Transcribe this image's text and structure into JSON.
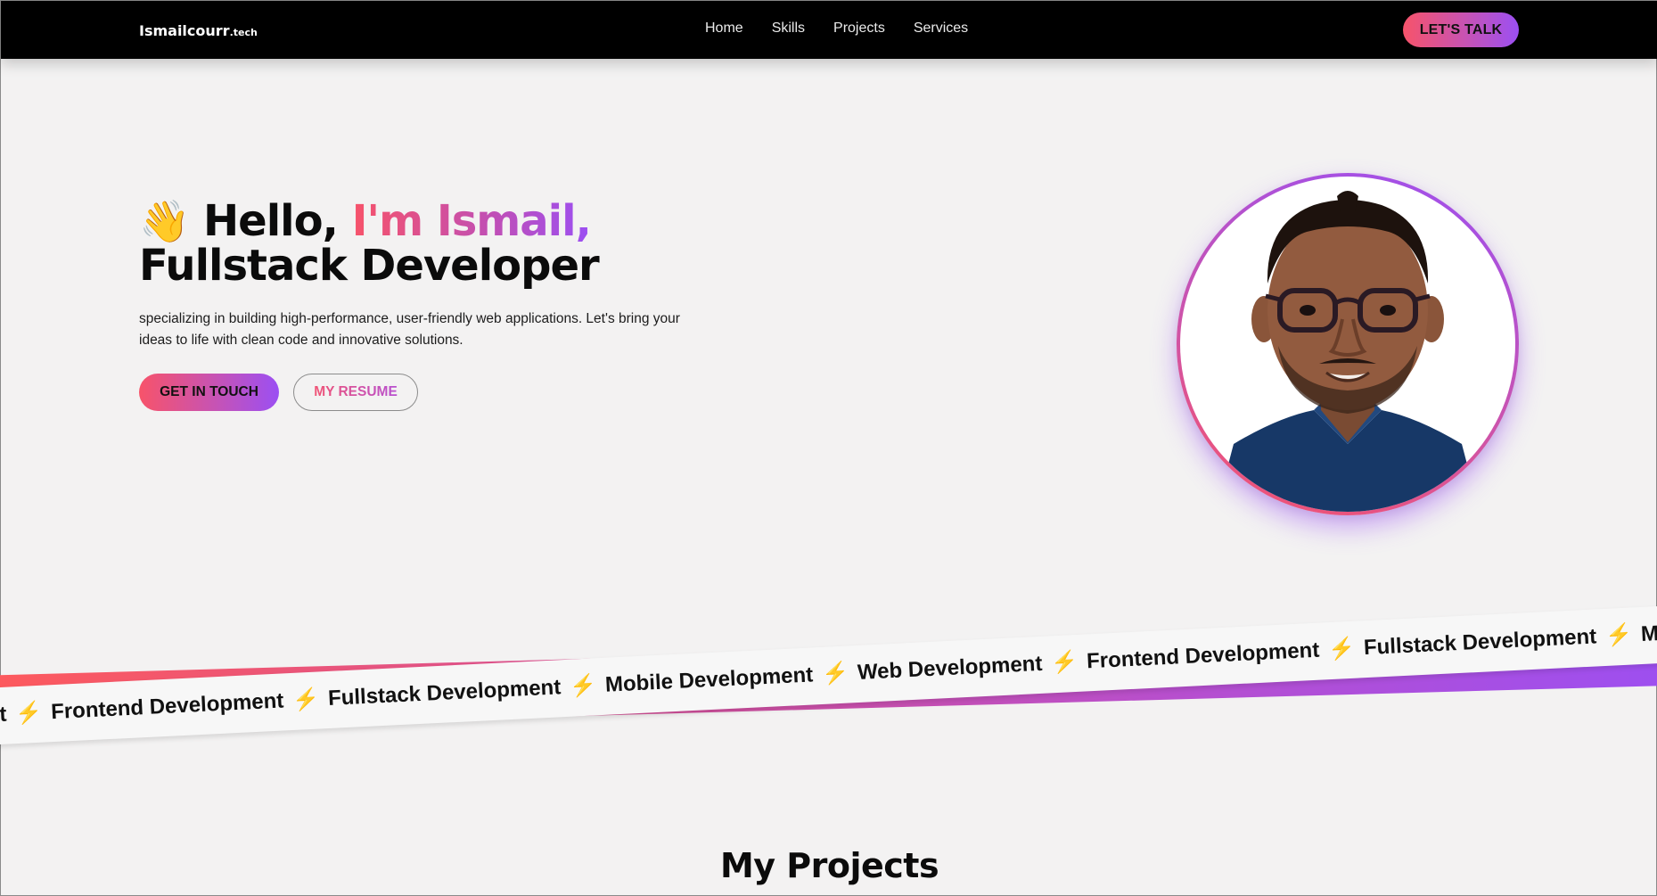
{
  "nav": {
    "logo_main": "Ismailcourr",
    "logo_tld": ".tech",
    "links": [
      "Home",
      "Skills",
      "Projects",
      "Services"
    ],
    "cta": "LET'S TALK"
  },
  "hero": {
    "wave": "👋",
    "hello": "Hello,",
    "name": "I'm Ismail,",
    "role": "Fullstack Developer",
    "description": "specializing in building high-performance, user-friendly web applications. Let's bring your ideas to life with clean code and innovative solutions.",
    "primary_button": "GET IN TOUCH",
    "secondary_button": "MY RESUME"
  },
  "marquee": {
    "items": [
      "ment",
      "Frontend Development",
      "Fullstack Development",
      "Mobile Development",
      "Web Development",
      "Frontend Development",
      "Fullstack Development",
      "Mobile Dev"
    ],
    "separator": "⚡"
  },
  "projects": {
    "title": "My Projects"
  },
  "colors": {
    "gradient_start": "#f7536a",
    "gradient_mid": "#c653b5",
    "gradient_end": "#9b4ff3",
    "navbar_bg": "#000000",
    "page_bg": "#f3f2f2"
  },
  "icons": [
    "waving-hand-icon",
    "lightning-bolt-icon"
  ]
}
